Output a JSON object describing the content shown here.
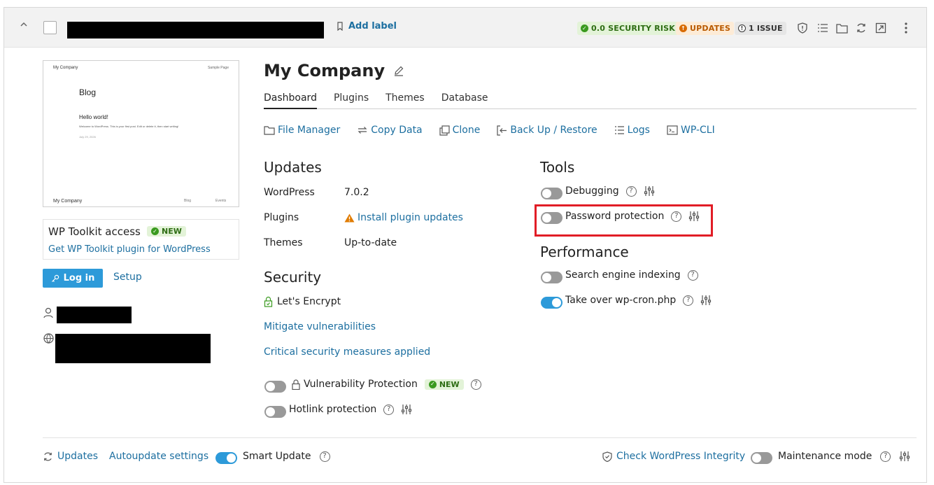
{
  "header": {
    "add_label": "Add label",
    "badges": {
      "security": "0.0 SECURITY RISK",
      "updates": "UPDATES",
      "issue": "1 ISSUE"
    }
  },
  "thumbnail": {
    "site_name": "My Company",
    "sample_page": "Sample Page",
    "blog": "Blog",
    "hello": "Hello world!",
    "welcome": "Welcome to WordPress. This is your first post. Edit or delete it, then start writing!",
    "date": "July 29, 2026",
    "footer_name": "My Company",
    "footer_blog": "Blog",
    "footer_events": "Events"
  },
  "toolkit": {
    "title": "WP Toolkit access",
    "new_badge": "NEW",
    "link": "Get WP Toolkit plugin for WordPress"
  },
  "login": {
    "button": "Log in",
    "setup": "Setup"
  },
  "site": {
    "title": "My Company"
  },
  "tabs": [
    "Dashboard",
    "Plugins",
    "Themes",
    "Database"
  ],
  "actions": [
    "File Manager",
    "Copy Data",
    "Clone",
    "Back Up / Restore",
    "Logs",
    "WP-CLI"
  ],
  "updates": {
    "heading": "Updates",
    "wordpress_label": "WordPress",
    "wordpress_value": "7.0.2",
    "plugins_label": "Plugins",
    "plugins_value": "Install plugin updates",
    "themes_label": "Themes",
    "themes_value": "Up-to-date"
  },
  "security": {
    "heading": "Security",
    "ssl": "Let's Encrypt",
    "mitigate": "Mitigate vulnerabilities",
    "critical": "Critical security measures applied",
    "vuln_protection": "Vulnerability Protection",
    "vuln_new": "NEW",
    "hotlink": "Hotlink protection"
  },
  "tools": {
    "heading": "Tools",
    "debugging": "Debugging",
    "password": "Password protection"
  },
  "performance": {
    "heading": "Performance",
    "indexing": "Search engine indexing",
    "wpcron": "Take over wp-cron.php"
  },
  "footer": {
    "updates": "Updates",
    "autoupdate": "Autoupdate settings",
    "smart_update": "Smart Update",
    "integrity": "Check WordPress Integrity",
    "maintenance": "Maintenance mode"
  },
  "toggles": {
    "debugging": false,
    "password": false,
    "indexing": false,
    "wpcron": true,
    "vuln_protection": false,
    "hotlink": false,
    "smart_update": true,
    "maintenance": false
  },
  "colors": {
    "link": "#1d6fa0",
    "toggle_on": "#2d9ad9",
    "highlight": "#e11d26"
  }
}
